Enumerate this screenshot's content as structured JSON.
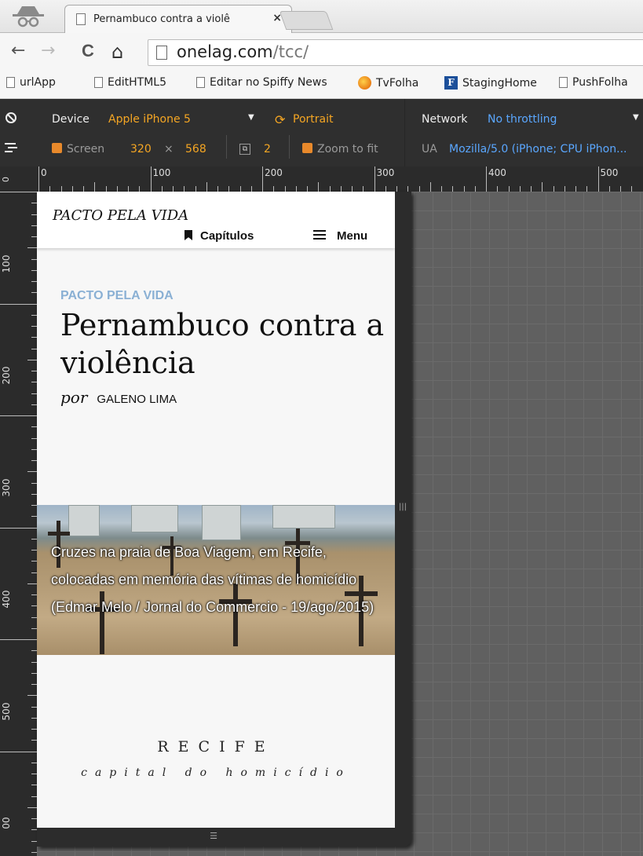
{
  "browser": {
    "tab": {
      "title": "Pernambuco contra a violê",
      "close": "×"
    },
    "nav": {
      "back": "←",
      "forward": "→",
      "reload": "C",
      "home": "⌂"
    },
    "address": {
      "host": "onelag.com",
      "path": "/tcc/"
    },
    "bookmarks": [
      "urlApp",
      "EditHTML5",
      "Editar no Spiffy News",
      "TvFolha",
      "StagingHome",
      "PushFolha"
    ]
  },
  "devtools": {
    "device_label": "Device",
    "device_value": "Apple iPhone 5",
    "orientation": "Portrait",
    "network_label": "Network",
    "network_value": "No throttling",
    "screen_label": "Screen",
    "screen_width": "320",
    "screen_times": "×",
    "screen_height": "568",
    "dpr": "2",
    "zoom_label": "Zoom to fit",
    "ua_label": "UA",
    "ua_value": "Mozilla/5.0 (iPhone; CPU iPhon...",
    "dropdown_caret": "▼"
  },
  "rulers": {
    "top": [
      "0",
      "100",
      "200",
      "300",
      "400",
      "500"
    ],
    "left": [
      "0",
      "100",
      "200",
      "300",
      "400",
      "500",
      "00"
    ]
  },
  "page": {
    "site_name": "PACTO PELA VIDA",
    "chapters_label": "Capítulos",
    "menu_label": "Menu",
    "kicker": "PACTO PELA VIDA",
    "headline": "Pernambuco contra a violência",
    "by": "por",
    "author": "GALENO LIMA",
    "caption": "Cruzes na praia de Boa Viagem, em Recife, colocadas em memória das vítimas de homicídio (Edmar Melo / Jornal do Commercio - 19/ago/2015)",
    "section_title": "RECIFE",
    "section_subtitle": "capital do homicídio"
  },
  "colors": {
    "devtools_orange": "#f5a623",
    "devtools_blue": "#5aa7ff",
    "kicker": "#8ab0d4"
  },
  "icons": [
    "incognito-icon",
    "page-icon",
    "reload-icon",
    "home-icon",
    "rotate-icon",
    "bookmark-icon",
    "hamburger-icon",
    "no-entry-icon",
    "device-mode-icon",
    "screenshot-icon"
  ]
}
